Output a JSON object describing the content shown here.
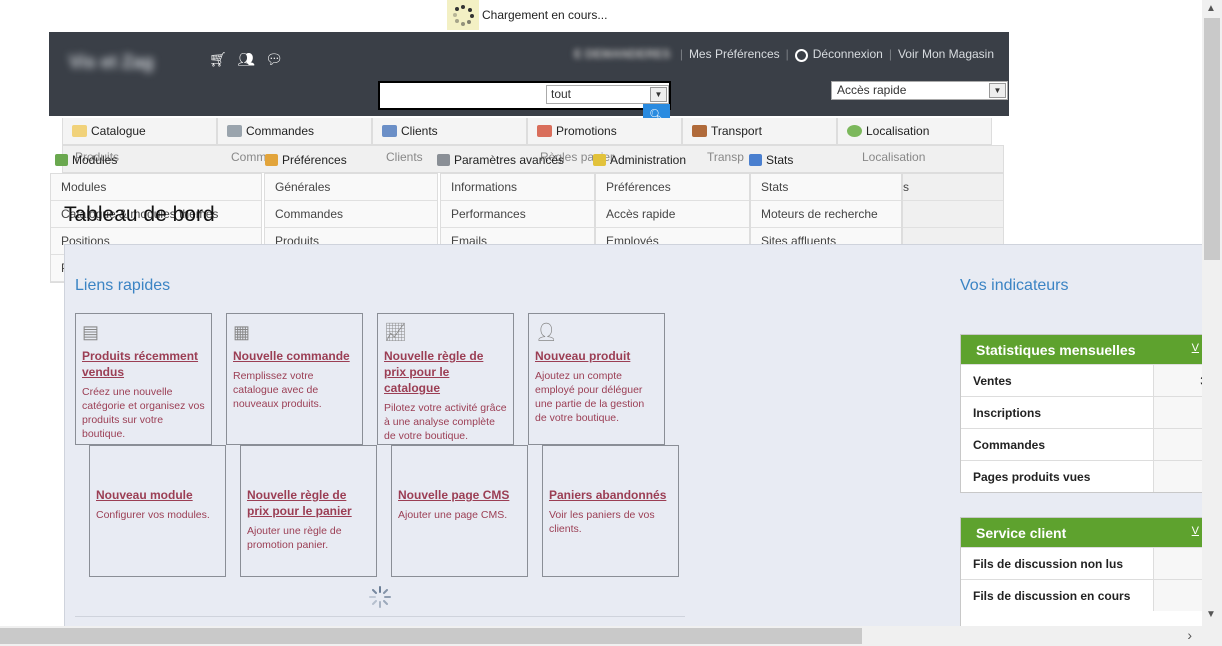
{
  "loading": {
    "text": "Chargement en cours..."
  },
  "header": {
    "shop_name": "Vis et Zag",
    "blurred_user": "E DEMANDERES",
    "links": {
      "preferences": "Mes Préférences",
      "logout": "Déconnexion",
      "shop": "Voir Mon Magasin"
    },
    "search": {
      "scope": "tout",
      "value": ""
    },
    "quick_access": "Accès rapide"
  },
  "menu": {
    "tabs": [
      "Catalogue",
      "Commandes",
      "Clients",
      "Promotions",
      "Transport",
      "Localisation"
    ],
    "ghost_sub": [
      "Produits",
      "Comm",
      "Clients",
      "Règles panier",
      "Transp",
      "Localisation"
    ],
    "row2": [
      "Modules",
      "Préférences",
      "Paramètres avancés",
      "Administration",
      "Stats"
    ]
  },
  "dropdowns": {
    "col1": [
      "Modules",
      "Catalogue & modules thèmes",
      "Positions",
      "P"
    ],
    "col2": [
      "Générales",
      "Commandes",
      "Produits"
    ],
    "col3": [
      "Informations",
      "Performances",
      "Emails"
    ],
    "col4": [
      "Préférences",
      "Accès rapide",
      "Employés"
    ],
    "col5": [
      "Stats",
      "Moteurs de recherche",
      "Sites affluents"
    ],
    "col6": [
      "s"
    ]
  },
  "page_title": "Tableau de bord",
  "quick_links": {
    "title": "Liens rapides",
    "tiles": [
      {
        "name": "Produits récemment vendus",
        "desc": "Créez une nouvelle catégorie et organisez vos produits sur votre boutique."
      },
      {
        "name": "Nouvelle commande",
        "desc": "Remplissez votre catalogue avec de nouveaux produits."
      },
      {
        "name": "Nouvelle règle de prix pour le catalogue",
        "desc": "Pilotez votre activité grâce à une analyse complète de votre boutique."
      },
      {
        "name": "Nouveau produit",
        "desc": "Ajoutez un compte employé pour déléguer une partie de la gestion de votre boutique."
      },
      {
        "name": "Nouveau module",
        "desc": "Configurer vos modules."
      },
      {
        "name": "Nouvelle règle de prix pour le panier",
        "desc": "Ajouter une règle de promotion panier."
      },
      {
        "name": "Nouvelle page CMS",
        "desc": "Ajouter une page CMS."
      },
      {
        "name": "Paniers abandonnés",
        "desc": "Voir les paniers de vos clients."
      }
    ]
  },
  "indicators": {
    "title": "Vos indicateurs",
    "monthly": {
      "title": "Statistiques mensuelles",
      "more": "V",
      "rows": [
        {
          "label": "Ventes",
          "value": "3:"
        },
        {
          "label": "Inscriptions",
          "value": ""
        },
        {
          "label": "Commandes",
          "value": ""
        },
        {
          "label": "Pages produits vues",
          "value": ""
        }
      ]
    },
    "service": {
      "title": "Service client",
      "more": "V",
      "rows": [
        {
          "label": "Fils de discussion non lus",
          "value": ""
        },
        {
          "label": "Fils de discussion en cours",
          "value": ""
        }
      ]
    }
  },
  "colors": {
    "header_bg": "#3a3f47",
    "accent_blue": "#3b84c4",
    "green": "#5ea22e",
    "link_red": "#9b3e54"
  }
}
